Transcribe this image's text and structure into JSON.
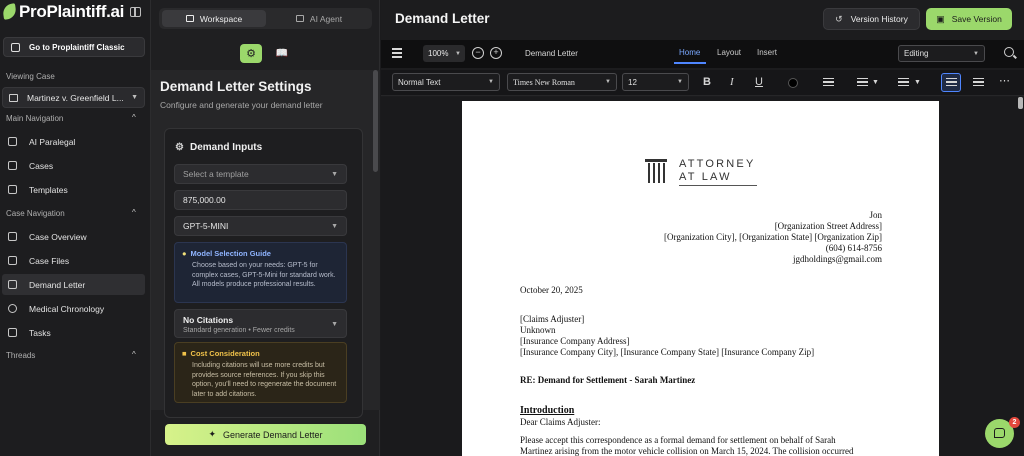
{
  "app": {
    "brand": "ProPlaintiff.ai"
  },
  "sidebar": {
    "classic_button": "Go to Proplaintiff Classic",
    "viewing_case_label": "Viewing Case",
    "case_name": "Martinez v. Greenfield L...",
    "main_nav_label": "Main Navigation",
    "main_items": [
      {
        "label": "AI Paralegal",
        "icon": "chat-icon"
      },
      {
        "label": "Cases",
        "icon": "briefcase-icon"
      },
      {
        "label": "Templates",
        "icon": "document-icon"
      }
    ],
    "case_nav_label": "Case Navigation",
    "case_items": [
      {
        "label": "Case Overview",
        "icon": "chart-icon"
      },
      {
        "label": "Case Files",
        "icon": "file-icon"
      },
      {
        "label": "Demand Letter",
        "icon": "mail-icon",
        "active": true
      },
      {
        "label": "Medical Chronology",
        "icon": "stethoscope-icon"
      },
      {
        "label": "Tasks",
        "icon": "checkbox-icon"
      }
    ],
    "threads_label": "Threads"
  },
  "panel": {
    "tabs": [
      {
        "label": "Workspace",
        "active": true
      },
      {
        "label": "AI Agent",
        "active": false
      }
    ],
    "title": "Demand Letter Settings",
    "subtitle": "Configure and generate your demand letter",
    "inputs_title": "Demand Inputs",
    "template_placeholder": "Select a template",
    "amount_value": "875,000.00",
    "model_value": "GPT-5-MINI",
    "guide_title": "Model Selection Guide",
    "guide_text": "Choose based on your needs: GPT-5 for complex cases, GPT-5-Mini for standard work. All models produce professional results.",
    "citations_title": "No Citations",
    "citations_sub": "Standard generation • Fewer credits",
    "cost_title": "Cost Consideration",
    "cost_text": "Including citations will use more credits but provides source references. If you skip this option, you'll need to regenerate the document later to add citations.",
    "generate_button": "Generate Demand Letter"
  },
  "editor": {
    "title": "Demand Letter",
    "version_history_button": "Version History",
    "save_version_button": "Save Version",
    "zoom": "100%",
    "doc_name": "Demand Letter",
    "menu_tabs": [
      {
        "label": "Home",
        "active": true
      },
      {
        "label": "Layout",
        "active": false
      },
      {
        "label": "Insert",
        "active": false
      }
    ],
    "mode": "Editing",
    "paragraph_style": "Normal Text",
    "font_family": "Times New Roman",
    "font_size": "12"
  },
  "letter": {
    "logo_line1": "ATTORNEY",
    "logo_line2": "AT LAW",
    "sender": [
      "Jon",
      "[Organization Street Address]",
      "[Organization City], [Organization State] [Organization Zip]",
      "(604) 614-8756",
      "jgdholdings@gmail.com"
    ],
    "date": "October 20, 2025",
    "recipient": [
      "[Claims Adjuster]",
      "Unknown",
      "[Insurance Company Address]",
      "[Insurance Company City], [Insurance Company State] [Insurance Company Zip]"
    ],
    "re_line": "RE: Demand for Settlement - Sarah Martinez",
    "intro_heading": "Introduction",
    "salutation": "Dear Claims Adjuster:",
    "body1": "Please accept this correspondence as a formal demand for settlement on behalf of Sarah",
    "body2": "Martinez arising from the motor vehicle collision on March 15, 2024. The collision occurred"
  },
  "chat": {
    "badge_count": "2"
  },
  "colors": {
    "accent_green": "#9bd86b",
    "link_blue": "#4f86ff",
    "badge_red": "#e2483d"
  }
}
